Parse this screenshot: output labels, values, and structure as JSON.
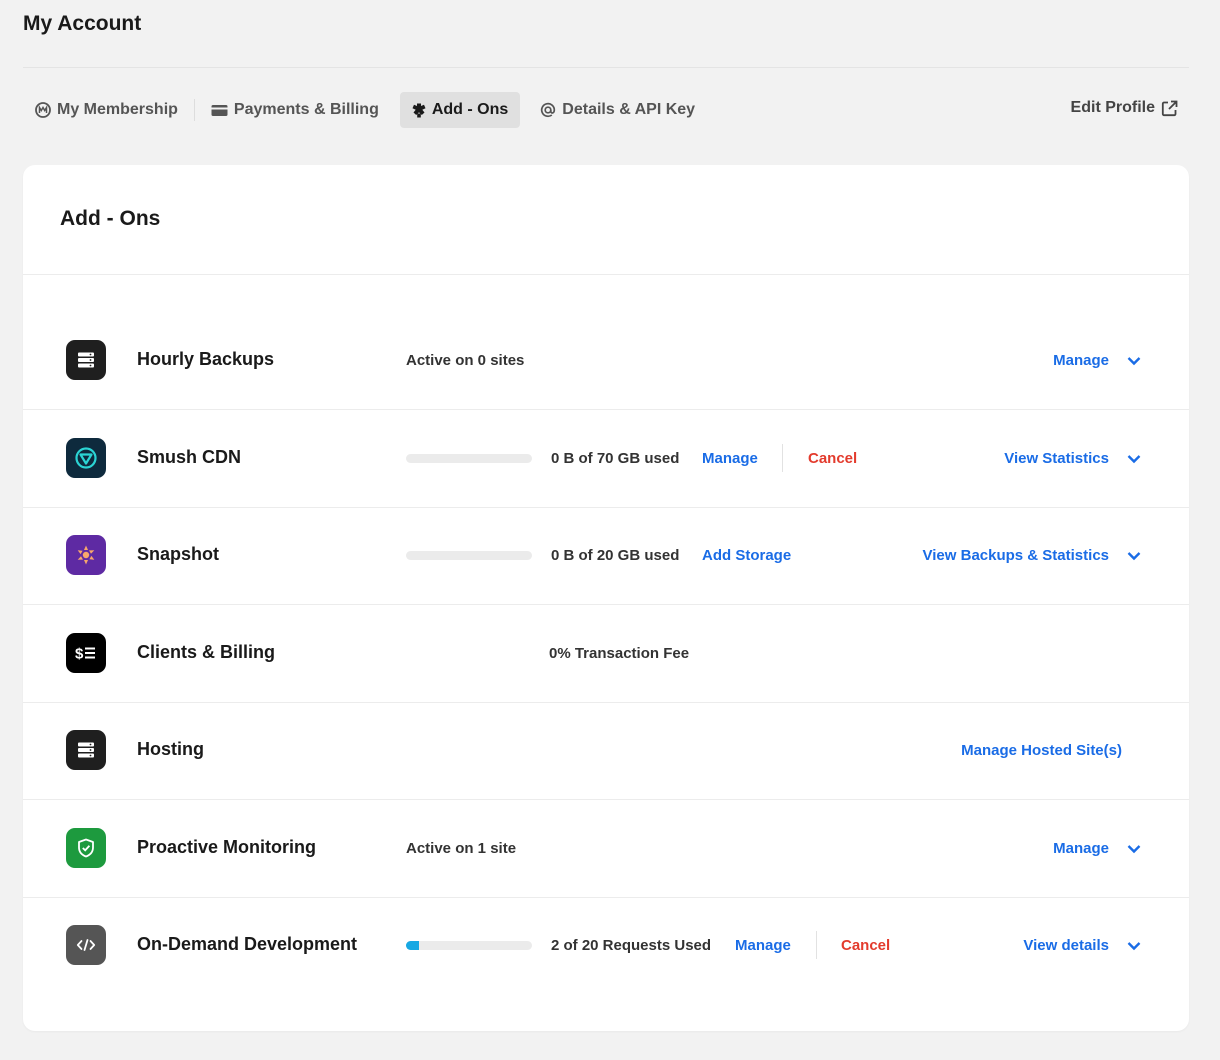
{
  "page": {
    "title": "My Account"
  },
  "tabs": [
    {
      "label": "My Membership",
      "icon": "membership-icon"
    },
    {
      "label": "Payments & Billing",
      "icon": "card-icon"
    },
    {
      "label": "Add - Ons",
      "icon": "puzzle-icon",
      "active": true
    },
    {
      "label": "Details & API Key",
      "icon": "at-icon"
    }
  ],
  "edit_profile": {
    "label": "Edit Profile",
    "icon": "external-link-icon"
  },
  "card": {
    "title": "Add - Ons"
  },
  "colors": {
    "link": "#1a6ce6",
    "danger": "#e33b2d",
    "smush": "#0e2a3d",
    "snapshot": "#5e2aa3",
    "monitoring": "#1d9a3e",
    "dark": "#1f1f1f"
  },
  "addons": [
    {
      "name": "Hourly Backups",
      "icon": "server-icon",
      "status": "Active on 0 sites",
      "right_action": "Manage"
    },
    {
      "name": "Smush CDN",
      "icon": "smush-icon",
      "usage": "0 B of 70 GB used",
      "usage_fraction": 0,
      "actions": [
        "Manage",
        "Cancel"
      ],
      "right_action": "View Statistics"
    },
    {
      "name": "Snapshot",
      "icon": "snapshot-icon",
      "usage": "0 B of 20 GB used",
      "usage_fraction": 0,
      "actions": [
        "Add Storage"
      ],
      "right_action": "View Backups & Statistics"
    },
    {
      "name": "Clients & Billing",
      "icon": "dollar-list-icon",
      "status": "0% Transaction Fee"
    },
    {
      "name": "Hosting",
      "icon": "server-icon",
      "right_action": "Manage Hosted Site(s)"
    },
    {
      "name": "Proactive Monitoring",
      "icon": "shield-check-icon",
      "status": "Active on 1 site",
      "right_action": "Manage"
    },
    {
      "name": "On-Demand Development",
      "icon": "code-icon",
      "usage": "2 of 20 Requests Used",
      "usage_fraction": 0.1,
      "actions": [
        "Manage",
        "Cancel"
      ],
      "right_action": "View details"
    }
  ]
}
